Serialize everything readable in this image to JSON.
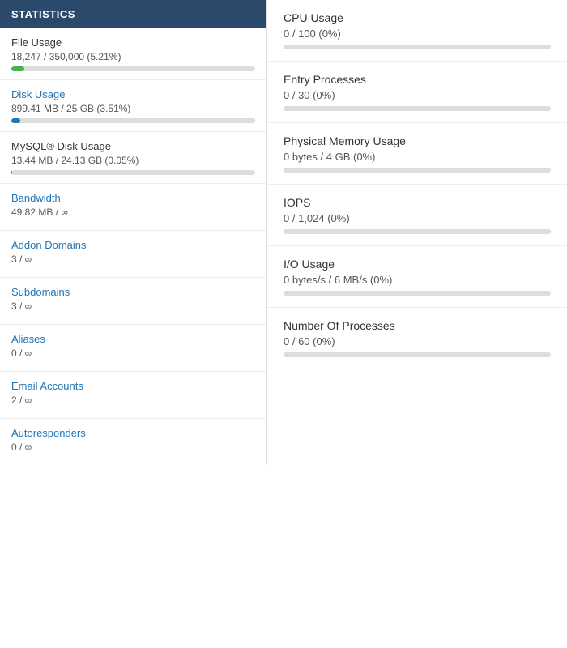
{
  "leftPanel": {
    "header": "STATISTICS",
    "items": [
      {
        "label": "File Usage",
        "isLink": false,
        "value": "18,247 / 350,000  (5.21%)",
        "hasBar": true,
        "fillColor": "fill-green",
        "fillPercent": 5.21
      },
      {
        "label": "Disk Usage",
        "isLink": true,
        "value": "899.41 MB / 25 GB  (3.51%)",
        "hasBar": true,
        "fillColor": "fill-blue",
        "fillPercent": 3.51
      },
      {
        "label": "MySQL® Disk Usage",
        "isLink": false,
        "value": "13.44 MB / 24.13 GB  (0.05%)",
        "hasBar": true,
        "fillColor": "fill-blue",
        "fillPercent": 0.05
      },
      {
        "label": "Bandwidth",
        "isLink": true,
        "value": "49.82 MB / ∞",
        "hasBar": false
      },
      {
        "label": "Addon Domains",
        "isLink": true,
        "value": "3 / ∞",
        "hasBar": false
      },
      {
        "label": "Subdomains",
        "isLink": true,
        "value": "3 / ∞",
        "hasBar": false
      },
      {
        "label": "Aliases",
        "isLink": true,
        "value": "0 / ∞",
        "hasBar": false
      },
      {
        "label": "Email Accounts",
        "isLink": true,
        "value": "2 / ∞",
        "hasBar": false
      },
      {
        "label": "Autoresponders",
        "isLink": true,
        "value": "0 / ∞",
        "hasBar": false
      }
    ]
  },
  "rightPanel": {
    "items": [
      {
        "label": "CPU Usage",
        "value": "0 / 100  (0%)",
        "fillPercent": 0,
        "fillColor": "fill-gray"
      },
      {
        "label": "Entry Processes",
        "value": "0 / 30  (0%)",
        "fillPercent": 0,
        "fillColor": "fill-gray"
      },
      {
        "label": "Physical Memory Usage",
        "value": "0 bytes / 4 GB  (0%)",
        "fillPercent": 0,
        "fillColor": "fill-gray"
      },
      {
        "label": "IOPS",
        "value": "0 / 1,024  (0%)",
        "fillPercent": 0,
        "fillColor": "fill-gray"
      },
      {
        "label": "I/O Usage",
        "value": "0 bytes/s / 6 MB/s  (0%)",
        "fillPercent": 0,
        "fillColor": "fill-gray"
      },
      {
        "label": "Number Of Processes",
        "value": "0 / 60  (0%)",
        "fillPercent": 0,
        "fillColor": "fill-gray"
      }
    ]
  }
}
